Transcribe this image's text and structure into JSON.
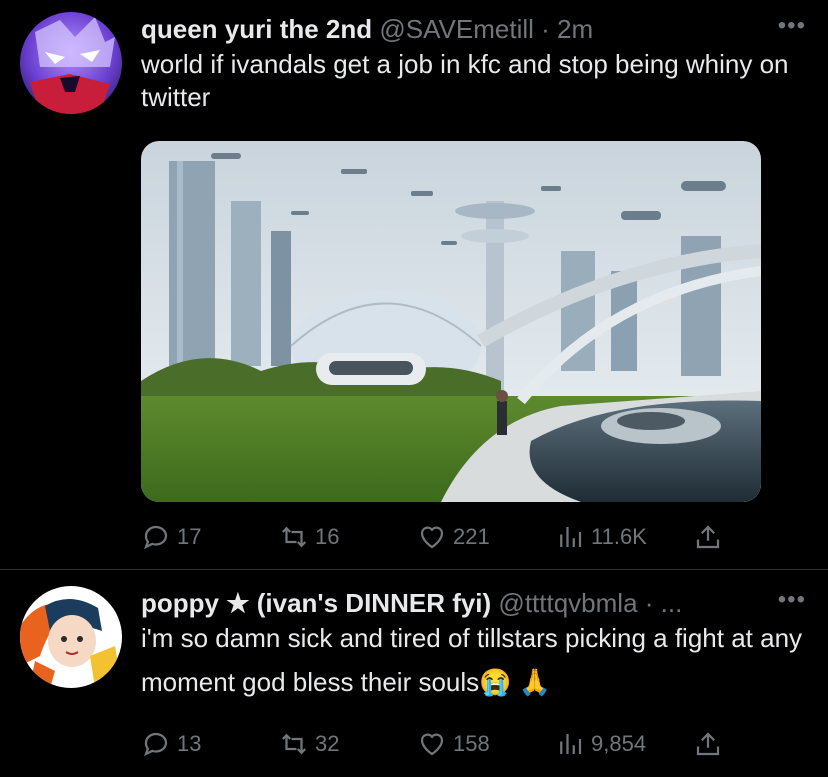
{
  "tweets": [
    {
      "display_name": "queen yuri the 2nd",
      "handle": "@SAVEmetill",
      "separator": "·",
      "time": "2m",
      "text": "world if ivandals get a job in kfc and stop being whiny on twitter",
      "more_icon": "more-icon",
      "replies": "17",
      "retweets": "16",
      "likes": "221",
      "views": "11.6K"
    },
    {
      "display_name": "poppy ★ (ivan's DINNER fyi)",
      "handle": "@ttttqvbmla",
      "separator": "·",
      "time": "...",
      "text": "i'm so damn sick and tired of tillstars picking a fight at any moment god bless their souls😭 🙏",
      "more_icon": "more-icon",
      "replies": "13",
      "retweets": "32",
      "likes": "158",
      "views": "9,854"
    }
  ],
  "more_label": "•••",
  "colors": {
    "background": "#000000",
    "text": "#e7e9ea",
    "muted": "#71767b",
    "divider": "#2f3336"
  }
}
